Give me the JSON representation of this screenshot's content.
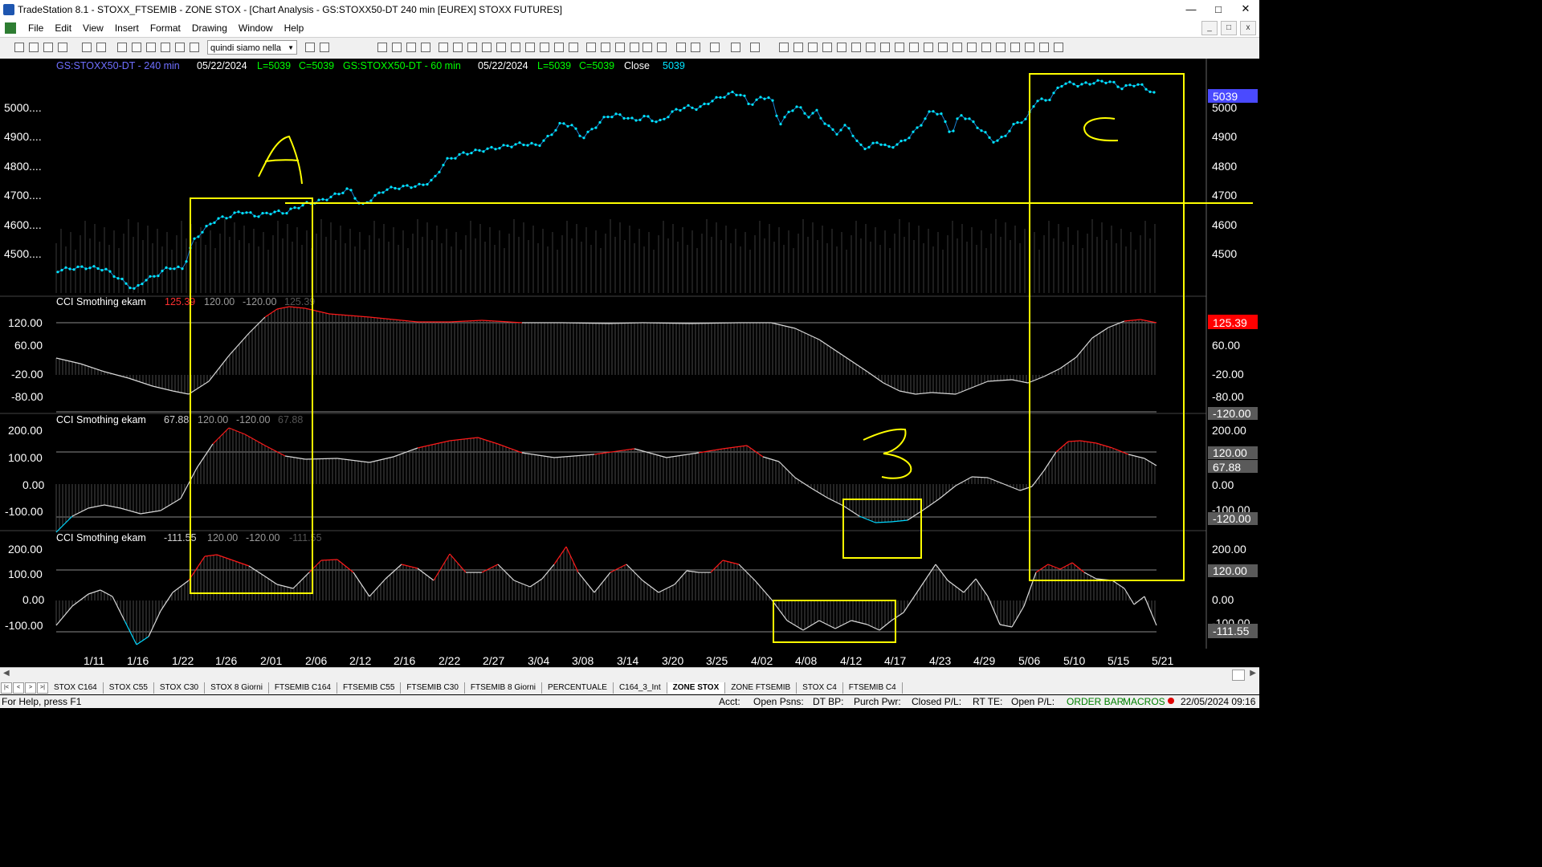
{
  "window": {
    "title": "TradeStation 8.1 - STOXX_FTSEMIB - ZONE STOX - [Chart Analysis - GS:STOXX50-DT  240 min  [EUREX] STOXX FUTURES]"
  },
  "menu": [
    "File",
    "Edit",
    "View",
    "Insert",
    "Format",
    "Drawing",
    "Window",
    "Help"
  ],
  "toolbar": {
    "combo_value": "quindi siamo nella"
  },
  "header": {
    "sym1": "GS:STOXX50-DT - 240 min",
    "date1": "05/22/2024",
    "low1": "L=5039",
    "close1": "C=5039",
    "sym2": "GS:STOXX50-DT - 60 min",
    "date2": "05/22/2024",
    "low2": "L=5039",
    "close2": "C=5039",
    "close_label": "Close",
    "close_val": "5039"
  },
  "price_axis": {
    "labels": [
      "5000....",
      "4900....",
      "4800....",
      "4700....",
      "4600....",
      "4500...."
    ],
    "right_labels": [
      "5000",
      "4900",
      "4800",
      "4700",
      "4600",
      "4500"
    ],
    "badge": "5039"
  },
  "panes": [
    {
      "name": "CCI Smothing ekam",
      "v1": "125.39",
      "v2": "120.00",
      "v3": "-120.00",
      "v4": "125.39",
      "left_labels": [
        "120.00",
        "60.00",
        "-20.00",
        "-80.00"
      ],
      "right_labels": [
        "60.00",
        "-20.00",
        "-80.00"
      ],
      "badge1": "125.39",
      "badge2": "-120.00"
    },
    {
      "name": "CCI Smothing ekam",
      "v1": "67.88",
      "v2": "120.00",
      "v3": "-120.00",
      "v4": "67.88",
      "left_labels": [
        "200.00",
        "100.00",
        "0.00",
        "-100.00"
      ],
      "right_labels": [
        "200.00",
        "0.00",
        "-100.00"
      ],
      "badge1": "120.00",
      "badge1b": "67.88",
      "badge2": "-120.00"
    },
    {
      "name": "CCI Smothing ekam",
      "v1": "-111.55",
      "v2": "120.00",
      "v3": "-120.00",
      "v4": "-111.55",
      "left_labels": [
        "200.00",
        "100.00",
        "0.00",
        "-100.00"
      ],
      "right_labels": [
        "200.00",
        "0.00",
        "-100.00"
      ],
      "badge1": "120.00",
      "badge2": "-111.55"
    }
  ],
  "xaxis": [
    "1/11",
    "1/16",
    "1/22",
    "1/26",
    "2/01",
    "2/06",
    "2/12",
    "2/16",
    "2/22",
    "2/27",
    "3/04",
    "3/08",
    "3/14",
    "3/20",
    "3/25",
    "4/02",
    "4/08",
    "4/12",
    "4/17",
    "4/23",
    "4/29",
    "5/06",
    "5/10",
    "5/15",
    "5/21"
  ],
  "annotations": [
    "A",
    "B",
    "C"
  ],
  "tabs": [
    "STOX C164",
    "STOX C55",
    "STOX  C30",
    "STOX  8 Giorni",
    "FTSEMIB C164",
    "FTSEMIB C55",
    "FTSEMIB C30",
    "FTSEMIB  8 Giorni",
    "PERCENTUALE",
    "C164_3_Int",
    "ZONE STOX",
    "ZONE FTSEMIB",
    "STOX  C4",
    "FTSEMIB C4"
  ],
  "active_tab": "ZONE STOX",
  "status": {
    "help": "For Help, press F1",
    "acct": "Acct:",
    "open_psns": "Open Psns:",
    "dt_bp": "DT BP:",
    "purch_pwr": "Purch Pwr:",
    "closed_pl": "Closed P/L:",
    "rt_te": "RT TE:",
    "open_pl": "Open P/L:",
    "order_bar": "ORDER BAR",
    "macros": "MACROS",
    "datetime": "22/05/2024 09:16"
  },
  "colors": {
    "price": "#00e5ff",
    "overbought": "#ff1a1a",
    "oversold": "#00d8ff",
    "cci": "#d9d9d9",
    "annotation": "#ffff00",
    "badge": "#5a5a5a"
  }
}
